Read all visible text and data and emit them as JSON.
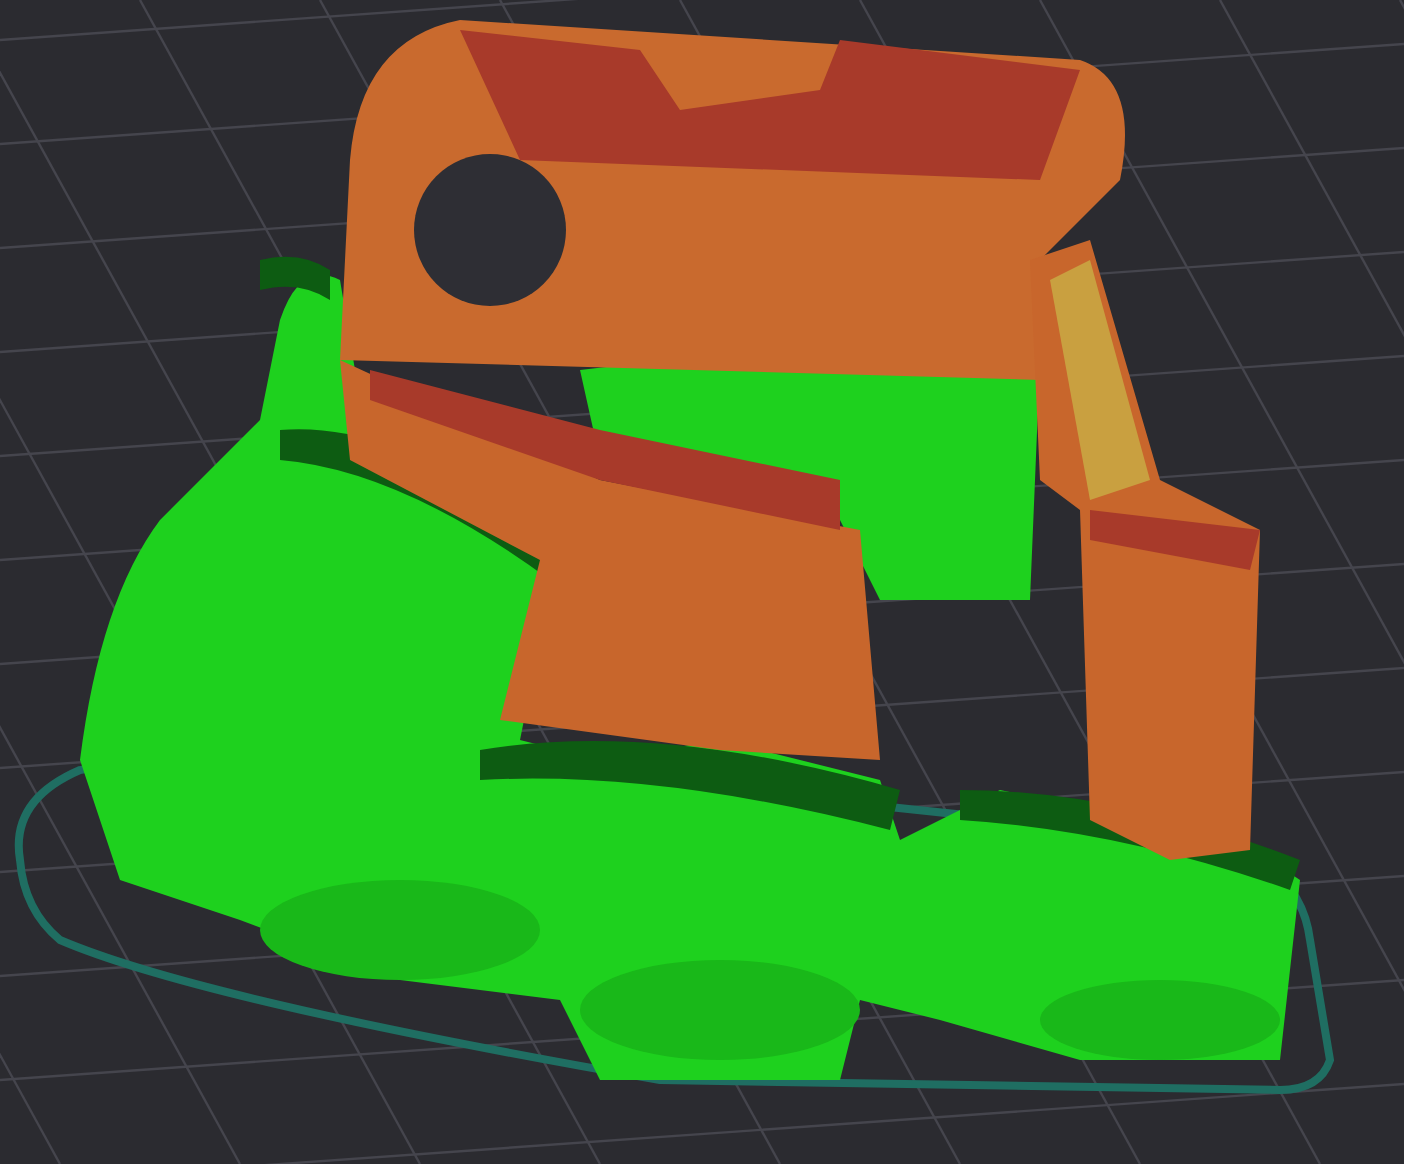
{
  "viewport": {
    "kind": "sliced-model"
  }
}
